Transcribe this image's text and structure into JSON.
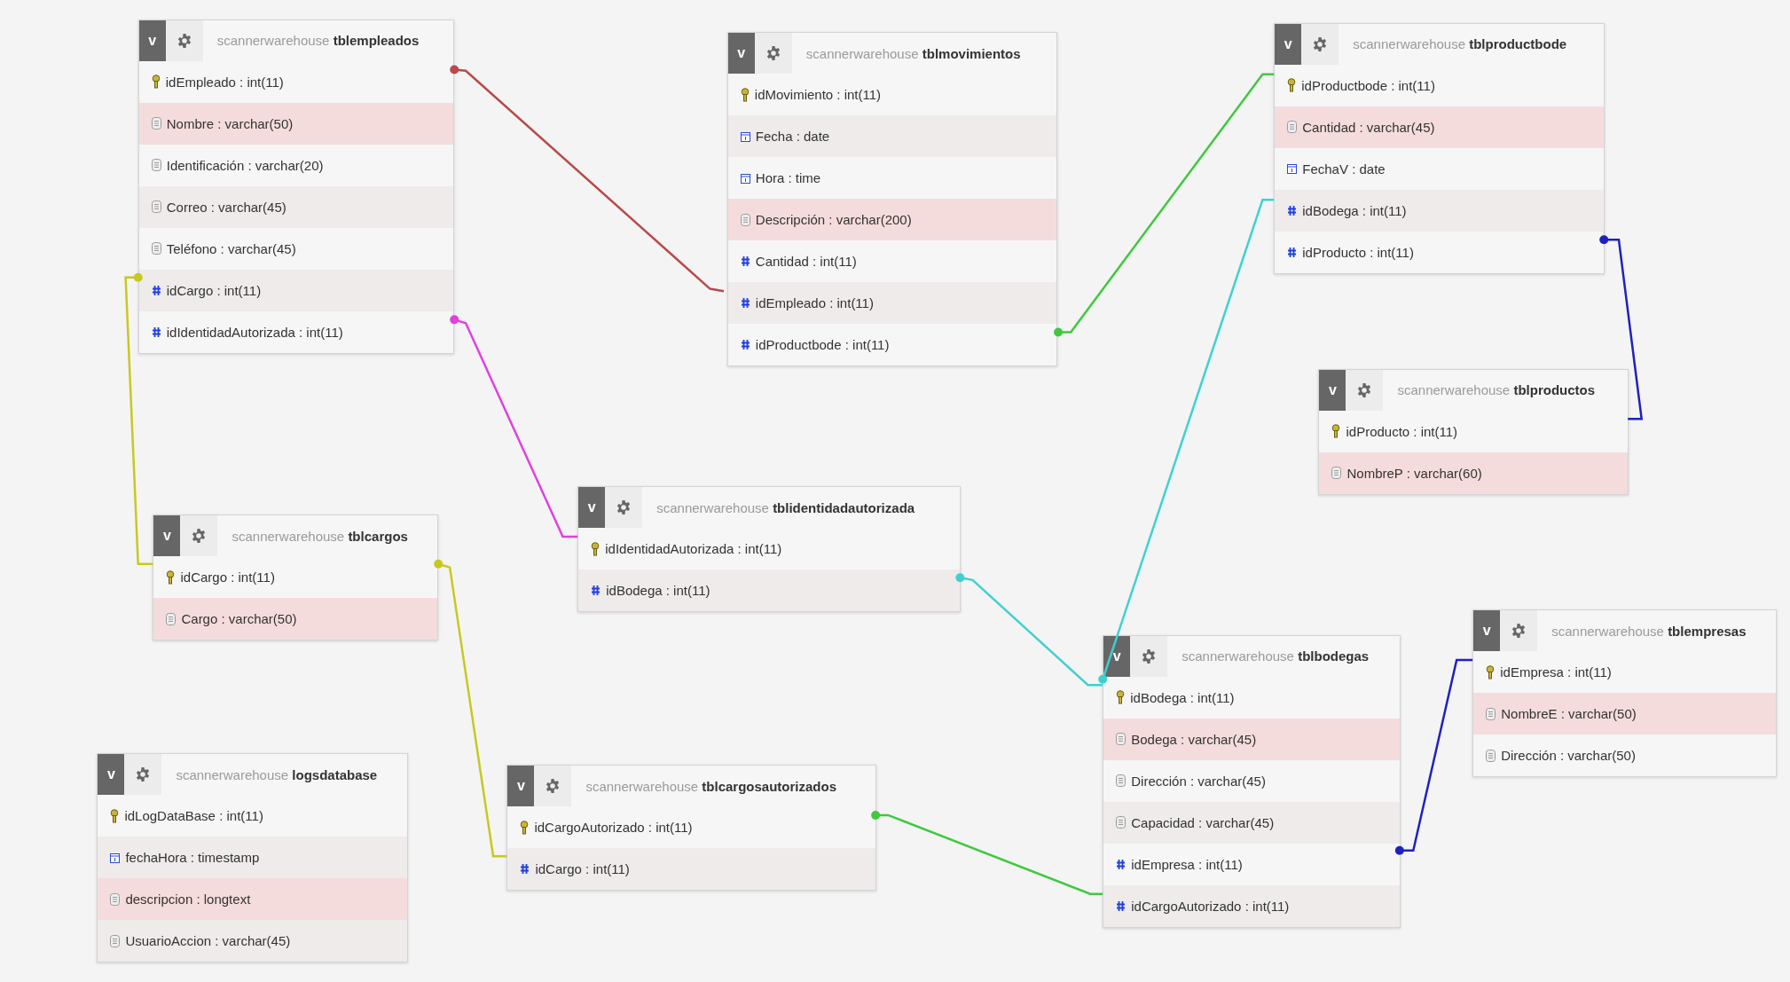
{
  "tables": [
    {
      "title": "scannerwarehouse **tblempleados**",
      "toggle": "v",
      "fields": [
        {
          "label": "idEmpleado : int(11)",
          "kind": "primary",
          "highlighted": false
        },
        {
          "label": "Nombre : varchar(50)",
          "kind": "text",
          "highlighted": true
        },
        {
          "label": "Identificación : varchar(20)",
          "kind": "text",
          "highlighted": false
        },
        {
          "label": "Correo : varchar(45)",
          "kind": "text",
          "highlighted": false
        },
        {
          "label": "Teléfono : varchar(45)",
          "kind": "text",
          "highlighted": false
        },
        {
          "label": "idCargo : int(11)",
          "kind": "number",
          "highlighted": false
        },
        {
          "label": "idIdentidadAutorizada : int(11)",
          "kind": "number",
          "highlighted": false
        }
      ]
    },
    {
      "title": "scannerwarehouse **tblmovimientos**",
      "toggle": "v",
      "fields": [
        {
          "label": "idMovimiento : int(11)",
          "kind": "primary",
          "highlighted": false
        },
        {
          "label": "Fecha : date",
          "kind": "date",
          "highlighted": false
        },
        {
          "label": "Hora : time",
          "kind": "date",
          "highlighted": false
        },
        {
          "label": "Descripción : varchar(200)",
          "kind": "text",
          "highlighted": true
        },
        {
          "label": "Cantidad : int(11)",
          "kind": "number",
          "highlighted": false
        },
        {
          "label": "idEmpleado : int(11)",
          "kind": "number",
          "highlighted": false
        },
        {
          "label": "idProductbode : int(11)",
          "kind": "number",
          "highlighted": false
        }
      ]
    },
    {
      "title": "scannerwarehouse **tblproductbode**",
      "toggle": "v",
      "fields": [
        {
          "label": "idProductbode : int(11)",
          "kind": "primary",
          "highlighted": false
        },
        {
          "label": "Cantidad : varchar(45)",
          "kind": "text",
          "highlighted": true
        },
        {
          "label": "FechaV : date",
          "kind": "date",
          "highlighted": false
        },
        {
          "label": "idBodega : int(11)",
          "kind": "number",
          "highlighted": false
        },
        {
          "label": "idProducto : int(11)",
          "kind": "number",
          "highlighted": false
        }
      ]
    },
    {
      "title": "scannerwarehouse **tblproductos**",
      "toggle": "v",
      "fields": [
        {
          "label": "idProducto : int(11)",
          "kind": "primary",
          "highlighted": false
        },
        {
          "label": "NombreP : varchar(60)",
          "kind": "text",
          "highlighted": true
        }
      ]
    },
    {
      "title": "scannerwarehouse **tblidentidadautorizada**",
      "toggle": "v",
      "fields": [
        {
          "label": "idIdentidadAutorizada : int(11)",
          "kind": "primary",
          "highlighted": false
        },
        {
          "label": "idBodega : int(11)",
          "kind": "number",
          "highlighted": false
        }
      ]
    },
    {
      "title": "scannerwarehouse **tblcargos**",
      "toggle": "v",
      "fields": [
        {
          "label": "idCargo : int(11)",
          "kind": "primary",
          "highlighted": false
        },
        {
          "label": "Cargo : varchar(50)",
          "kind": "text",
          "highlighted": true
        }
      ]
    },
    {
      "title": "scannerwarehouse **tblbodegas**",
      "toggle": "v",
      "fields": [
        {
          "label": "idBodega : int(11)",
          "kind": "primary",
          "highlighted": false
        },
        {
          "label": "Bodega : varchar(45)",
          "kind": "text",
          "highlighted": true
        },
        {
          "label": "Dirección : varchar(45)",
          "kind": "text",
          "highlighted": false
        },
        {
          "label": "Capacidad : varchar(45)",
          "kind": "text",
          "highlighted": false
        },
        {
          "label": "idEmpresa : int(11)",
          "kind": "number",
          "highlighted": false
        },
        {
          "label": "idCargoAutorizado : int(11)",
          "kind": "number",
          "highlighted": false
        }
      ]
    },
    {
      "title": "scannerwarehouse **tblempresas**",
      "toggle": "v",
      "fields": [
        {
          "label": "idEmpresa : int(11)",
          "kind": "primary",
          "highlighted": false
        },
        {
          "label": "NombreE : varchar(50)",
          "kind": "text",
          "highlighted": true
        },
        {
          "label": "Dirección : varchar(50)",
          "kind": "text",
          "highlighted": false
        }
      ]
    },
    {
      "title": "scannerwarehouse **logsdatabase**",
      "toggle": "v",
      "fields": [
        {
          "label": "idLogDataBase : int(11)",
          "kind": "primary",
          "highlighted": false
        },
        {
          "label": "fechaHora : timestamp",
          "kind": "date",
          "highlighted": false
        },
        {
          "label": "descripcion : longtext",
          "kind": "text",
          "highlighted": true
        },
        {
          "label": "UsuarioAccion : varchar(45)",
          "kind": "text",
          "highlighted": false
        }
      ]
    },
    {
      "title": "scannerwarehouse **tblcargosautorizados**",
      "toggle": "v",
      "fields": [
        {
          "label": "idCargoAutorizado : int(11)",
          "kind": "primary",
          "highlighted": false
        },
        {
          "label": "idCargo : int(11)",
          "kind": "number",
          "highlighted": false
        }
      ]
    }
  ],
  "relations": [
    {
      "color": "#b94a4a"
    },
    {
      "color": "#e040e0"
    },
    {
      "color": "#c8c820"
    },
    {
      "color": "#c8c820"
    },
    {
      "color": "#40c840"
    },
    {
      "color": "#40d0d0"
    },
    {
      "color": "#40d0d0"
    },
    {
      "color": "#2020c0"
    },
    {
      "color": "#2020c0"
    },
    {
      "color": "#40c840"
    }
  ]
}
